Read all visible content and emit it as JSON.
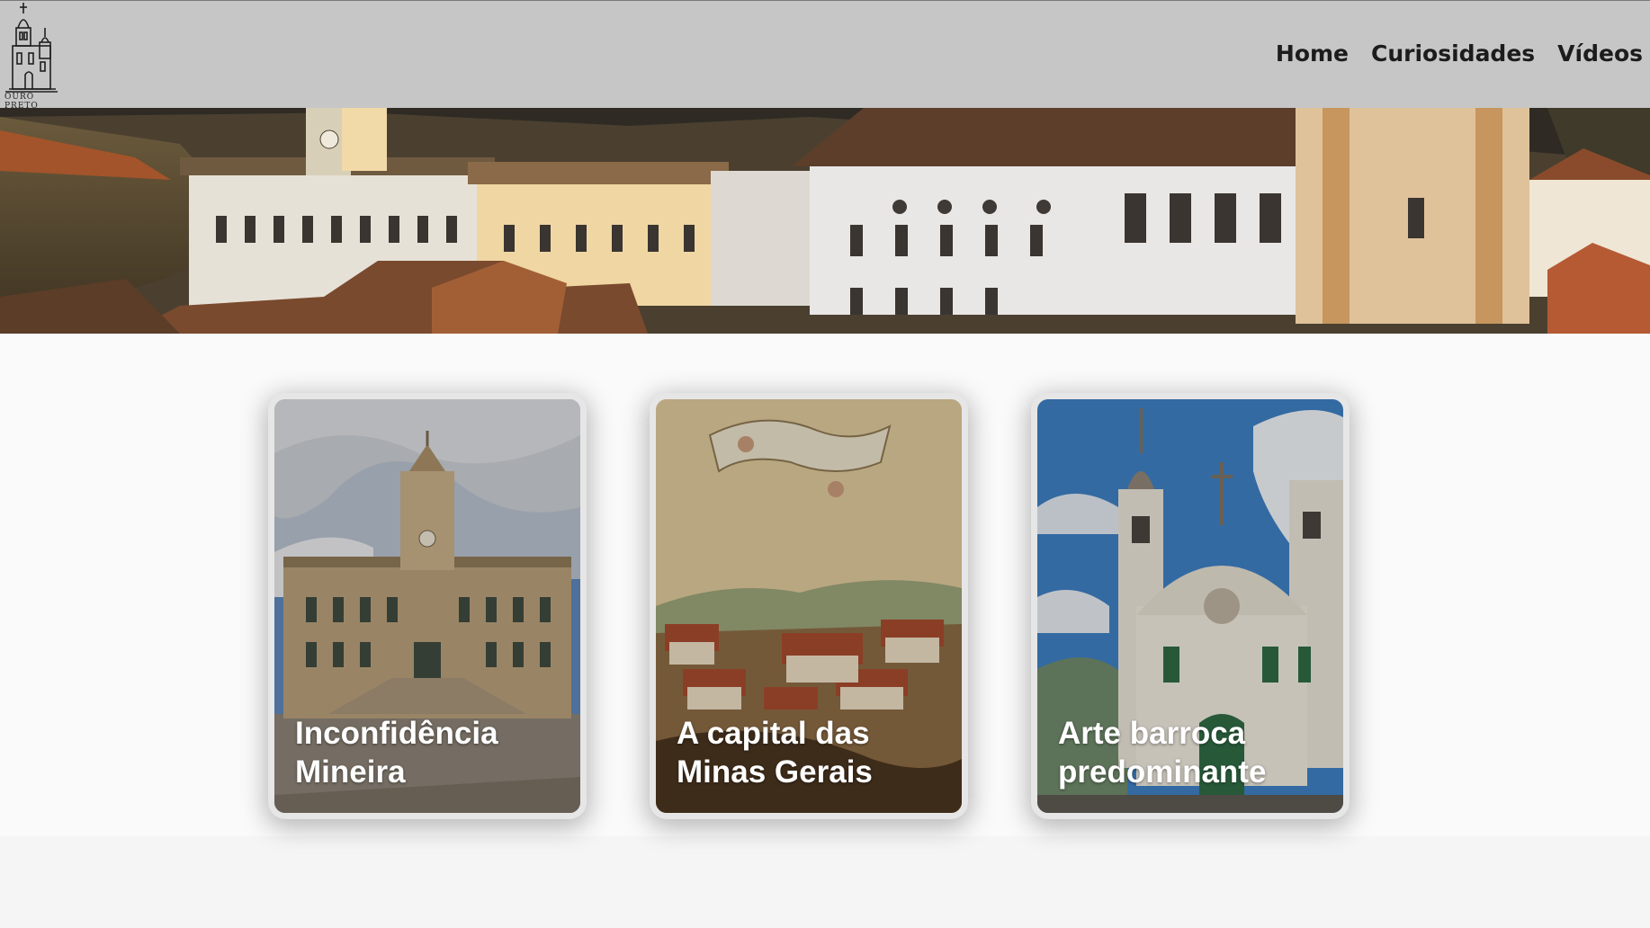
{
  "header": {
    "logo": {
      "caption": "OURO PRETO",
      "icon": "church-tower-logo-icon"
    },
    "nav": [
      {
        "label": "Home"
      },
      {
        "label": "Curiosidades"
      },
      {
        "label": "Vídeos"
      }
    ]
  },
  "hero": {
    "image": "ouro-preto-panorama-image"
  },
  "cards": [
    {
      "title": "Inconfidência Mineira",
      "image": "museu-da-inconfidencia-image"
    },
    {
      "title": "A capital das Minas Gerais",
      "image": "historic-painting-vila-rica-image"
    },
    {
      "title": "Arte barroca predominante",
      "image": "baroque-church-image"
    }
  ],
  "colors": {
    "header_bg": "#c6c6c6",
    "nav_text": "#1c1c1c",
    "page_bg": "#fafafa",
    "card_title": "#ffffff"
  }
}
